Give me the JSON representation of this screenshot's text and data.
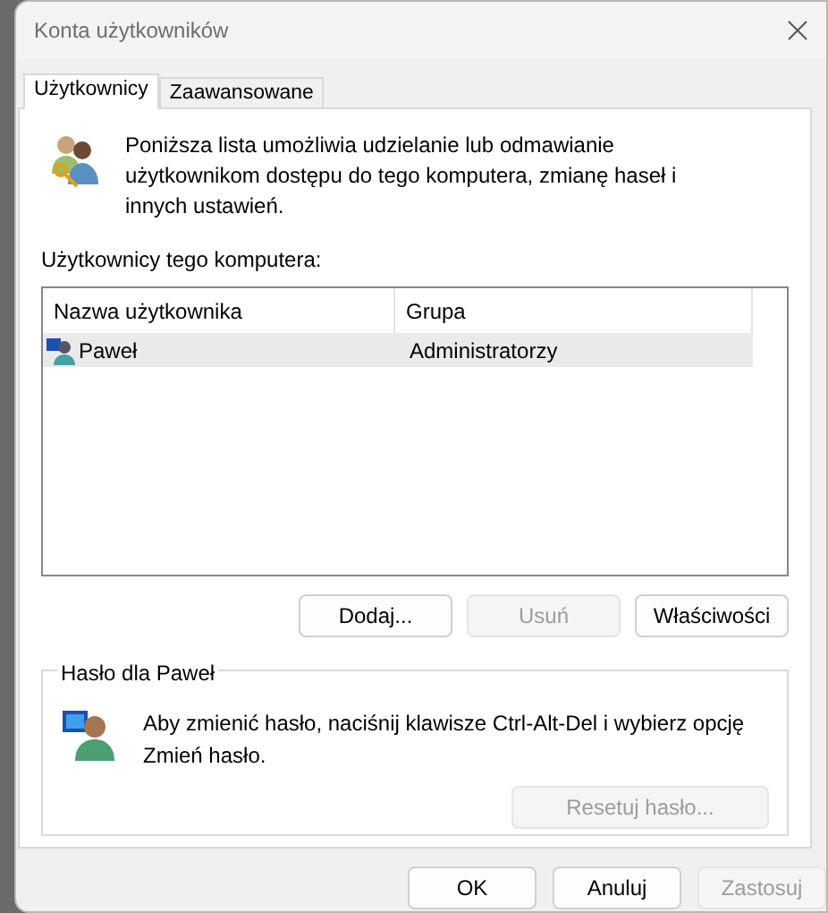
{
  "window": {
    "title": "Konta użytkowników"
  },
  "tabs": [
    {
      "label": "Użytkownicy",
      "selected": true
    },
    {
      "label": "Zaawansowane",
      "selected": false
    }
  ],
  "intro": "Poniższa lista umożliwia udzielanie lub odmawianie użytkownikom dostępu do tego komputera, zmianę haseł i innych ustawień.",
  "users_label": "Użytkownicy tego komputera:",
  "table": {
    "columns": [
      "Nazwa użytkownika",
      "Grupa"
    ],
    "rows": [
      {
        "name": "Paweł",
        "group": "Administratorzy",
        "selected": true
      }
    ]
  },
  "user_buttons": [
    {
      "label": "Dodaj...",
      "disabled": false
    },
    {
      "label": "Usuń",
      "disabled": true
    },
    {
      "label": "Właściwości",
      "disabled": false
    }
  ],
  "password": {
    "title": "Hasło dla Paweł",
    "text": "Aby zmienić hasło, naciśnij klawisze Ctrl-Alt-Del i wybierz opcję Zmień hasło.",
    "button": {
      "label": "Resetuj hasło...",
      "disabled": true
    }
  },
  "buttons": [
    {
      "label": "OK",
      "disabled": false
    },
    {
      "label": "Anuluj",
      "disabled": false
    },
    {
      "label": "Zastosuj",
      "disabled": true
    }
  ]
}
